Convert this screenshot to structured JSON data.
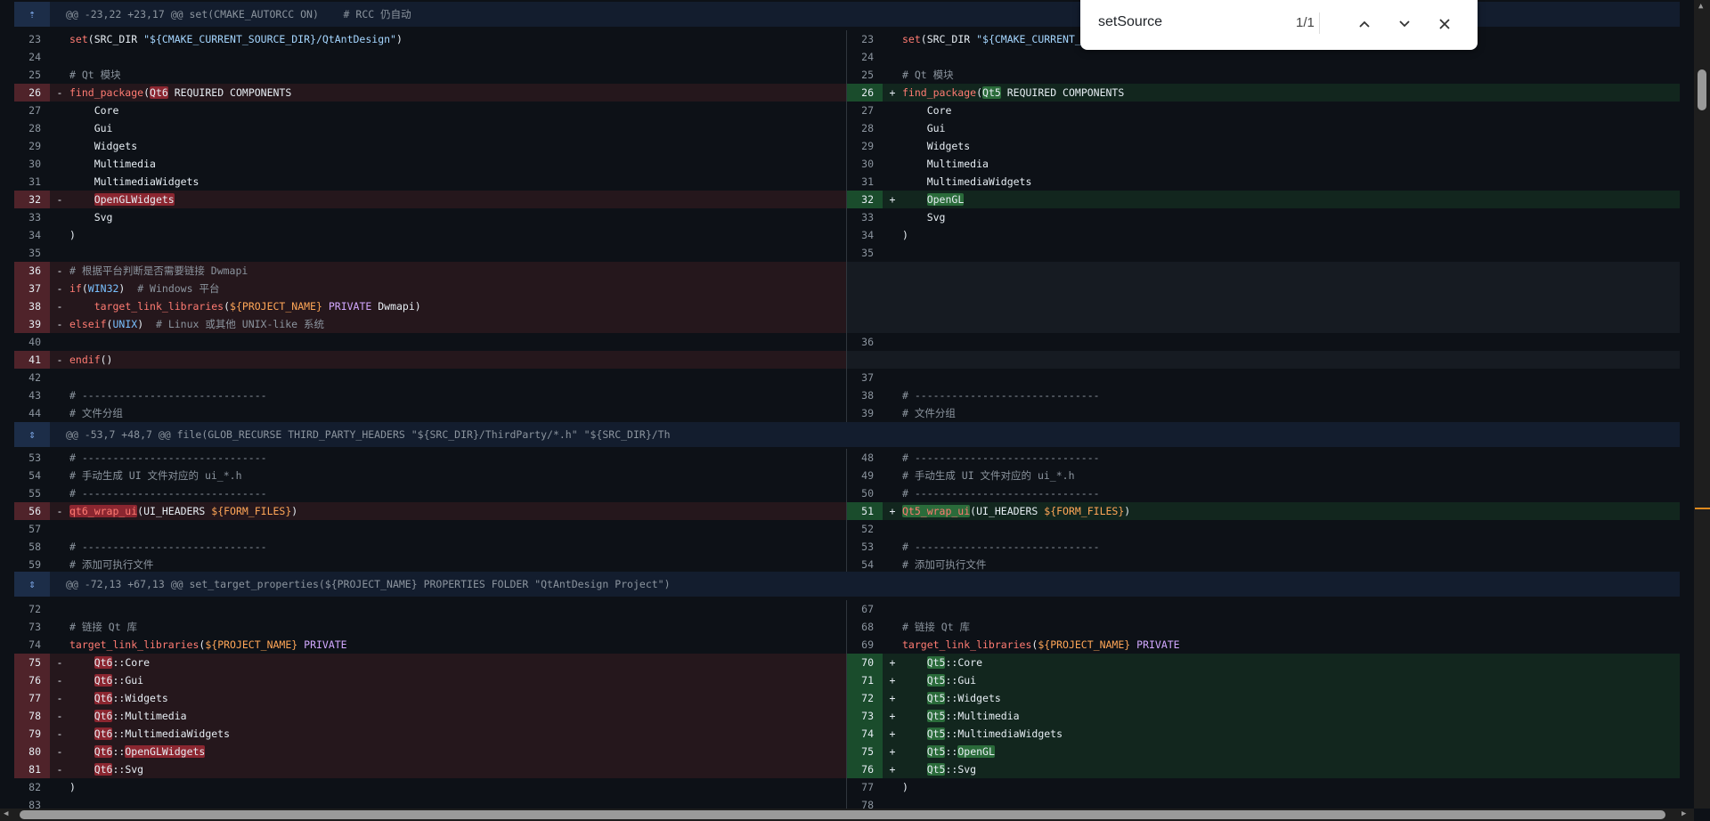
{
  "hunks": [
    {
      "text": "@@ -23,22 +23,17 @@ set(CMAKE_AUTORCC ON)    # RCC 仍自动",
      "expand_icon": "expand-up-icon"
    },
    {
      "text": "@@ -53,7 +48,7 @@ file(GLOB_RECURSE THIRD_PARTY_HEADERS \"${SRC_DIR}/ThirdParty/*.h\" \"${SRC_DIR}/Th",
      "expand_icon": "expand-both-icon"
    },
    {
      "text": "@@ -72,13 +67,13 @@ set_target_properties(${PROJECT_NAME} PROPERTIES FOLDER \"QtAntDesign Project\")",
      "expand_icon": "expand-both-icon"
    }
  ],
  "sections": [
    [
      {
        "l": {
          "n": "23",
          "c": "set(SRC_DIR \"${CMAKE_CURRENT_SOURCE_DIR}/QtAntDesign\")"
        },
        "r": {
          "n": "23",
          "c": "set(SRC_DIR \"${CMAKE_CURRENT_SOURCE_DIR}/QtAntDesign\")"
        }
      },
      {
        "l": {
          "n": "24",
          "c": ""
        },
        "r": {
          "n": "24",
          "c": ""
        }
      },
      {
        "l": {
          "n": "25",
          "c": "# Qt 模块"
        },
        "r": {
          "n": "25",
          "c": "# Qt 模块"
        }
      },
      {
        "l": {
          "n": "26",
          "c": "find_package(Qt6 REQUIRED COMPONENTS",
          "t": "del"
        },
        "r": {
          "n": "26",
          "c": "find_package(Qt5 REQUIRED COMPONENTS",
          "t": "add"
        }
      },
      {
        "l": {
          "n": "27",
          "c": "    Core"
        },
        "r": {
          "n": "27",
          "c": "    Core"
        }
      },
      {
        "l": {
          "n": "28",
          "c": "    Gui"
        },
        "r": {
          "n": "28",
          "c": "    Gui"
        }
      },
      {
        "l": {
          "n": "29",
          "c": "    Widgets"
        },
        "r": {
          "n": "29",
          "c": "    Widgets"
        }
      },
      {
        "l": {
          "n": "30",
          "c": "    Multimedia"
        },
        "r": {
          "n": "30",
          "c": "    Multimedia"
        }
      },
      {
        "l": {
          "n": "31",
          "c": "    MultimediaWidgets"
        },
        "r": {
          "n": "31",
          "c": "    MultimediaWidgets"
        }
      },
      {
        "l": {
          "n": "32",
          "c": "    OpenGLWidgets",
          "t": "del"
        },
        "r": {
          "n": "32",
          "c": "    OpenGL",
          "t": "add"
        }
      },
      {
        "l": {
          "n": "33",
          "c": "    Svg"
        },
        "r": {
          "n": "33",
          "c": "    Svg"
        }
      },
      {
        "l": {
          "n": "34",
          "c": ")"
        },
        "r": {
          "n": "34",
          "c": ")"
        }
      },
      {
        "l": {
          "n": "35",
          "c": ""
        },
        "r": {
          "n": "35",
          "c": ""
        }
      },
      {
        "l": {
          "n": "36",
          "c": "# 根据平台判断是否需要链接 Dwmapi",
          "t": "del"
        },
        "r": {
          "t": "empty"
        }
      },
      {
        "l": {
          "n": "37",
          "c": "if(WIN32)  # Windows 平台",
          "t": "del"
        },
        "r": {
          "t": "empty"
        }
      },
      {
        "l": {
          "n": "38",
          "c": "    target_link_libraries(${PROJECT_NAME} PRIVATE Dwmapi)",
          "t": "del"
        },
        "r": {
          "t": "empty"
        }
      },
      {
        "l": {
          "n": "39",
          "c": "elseif(UNIX)  # Linux 或其他 UNIX-like 系统",
          "t": "del"
        },
        "r": {
          "t": "empty"
        }
      },
      {
        "l": {
          "n": "40",
          "c": ""
        },
        "r": {
          "n": "36",
          "c": ""
        }
      },
      {
        "l": {
          "n": "41",
          "c": "endif()",
          "t": "del"
        },
        "r": {
          "t": "empty"
        }
      },
      {
        "l": {
          "n": "42",
          "c": ""
        },
        "r": {
          "n": "37",
          "c": ""
        }
      },
      {
        "l": {
          "n": "43",
          "c": "# ------------------------------"
        },
        "r": {
          "n": "38",
          "c": "# ------------------------------"
        }
      },
      {
        "l": {
          "n": "44",
          "c": "# 文件分组"
        },
        "r": {
          "n": "39",
          "c": "# 文件分组"
        }
      }
    ],
    [
      {
        "l": {
          "n": "53",
          "c": "# ------------------------------"
        },
        "r": {
          "n": "48",
          "c": "# ------------------------------"
        }
      },
      {
        "l": {
          "n": "54",
          "c": "# 手动生成 UI 文件对应的 ui_*.h"
        },
        "r": {
          "n": "49",
          "c": "# 手动生成 UI 文件对应的 ui_*.h"
        }
      },
      {
        "l": {
          "n": "55",
          "c": "# ------------------------------"
        },
        "r": {
          "n": "50",
          "c": "# ------------------------------"
        }
      },
      {
        "l": {
          "n": "56",
          "c": "qt6_wrap_ui(UI_HEADERS ${FORM_FILES})",
          "t": "del"
        },
        "r": {
          "n": "51",
          "c": "Qt5_wrap_ui(UI_HEADERS ${FORM_FILES})",
          "t": "add"
        }
      },
      {
        "l": {
          "n": "57",
          "c": ""
        },
        "r": {
          "n": "52",
          "c": ""
        }
      },
      {
        "l": {
          "n": "58",
          "c": "# ------------------------------"
        },
        "r": {
          "n": "53",
          "c": "# ------------------------------"
        }
      },
      {
        "l": {
          "n": "59",
          "c": "# 添加可执行文件"
        },
        "r": {
          "n": "54",
          "c": "# 添加可执行文件"
        }
      }
    ],
    [
      {
        "l": {
          "n": "72",
          "c": ""
        },
        "r": {
          "n": "67",
          "c": ""
        }
      },
      {
        "l": {
          "n": "73",
          "c": "# 链接 Qt 库"
        },
        "r": {
          "n": "68",
          "c": "# 链接 Qt 库"
        }
      },
      {
        "l": {
          "n": "74",
          "c": "target_link_libraries(${PROJECT_NAME} PRIVATE"
        },
        "r": {
          "n": "69",
          "c": "target_link_libraries(${PROJECT_NAME} PRIVATE"
        }
      },
      {
        "l": {
          "n": "75",
          "c": "    Qt6::Core",
          "t": "del"
        },
        "r": {
          "n": "70",
          "c": "    Qt5::Core",
          "t": "add"
        }
      },
      {
        "l": {
          "n": "76",
          "c": "    Qt6::Gui",
          "t": "del"
        },
        "r": {
          "n": "71",
          "c": "    Qt5::Gui",
          "t": "add"
        }
      },
      {
        "l": {
          "n": "77",
          "c": "    Qt6::Widgets",
          "t": "del"
        },
        "r": {
          "n": "72",
          "c": "    Qt5::Widgets",
          "t": "add"
        }
      },
      {
        "l": {
          "n": "78",
          "c": "    Qt6::Multimedia",
          "t": "del"
        },
        "r": {
          "n": "73",
          "c": "    Qt5::Multimedia",
          "t": "add"
        }
      },
      {
        "l": {
          "n": "79",
          "c": "    Qt6::MultimediaWidgets",
          "t": "del"
        },
        "r": {
          "n": "74",
          "c": "    Qt5::MultimediaWidgets",
          "t": "add"
        }
      },
      {
        "l": {
          "n": "80",
          "c": "    Qt6::OpenGLWidgets",
          "t": "del"
        },
        "r": {
          "n": "75",
          "c": "    Qt5::OpenGL",
          "t": "add"
        }
      },
      {
        "l": {
          "n": "81",
          "c": "    Qt6::Svg",
          "t": "del"
        },
        "r": {
          "n": "76",
          "c": "    Qt5::Svg",
          "t": "add"
        }
      },
      {
        "l": {
          "n": "82",
          "c": ")"
        },
        "r": {
          "n": "77",
          "c": ")"
        }
      },
      {
        "l": {
          "n": "83",
          "c": ""
        },
        "r": {
          "n": "78",
          "c": ""
        }
      }
    ]
  ],
  "markers": {
    "del": "-",
    "add": "+"
  },
  "find": {
    "query": "setSource",
    "count": "1/1",
    "prev_icon": "chevron-up-icon",
    "next_icon": "chevron-down-icon",
    "close_icon": "close-icon"
  },
  "colors": {
    "background": "#0d1117",
    "del_bg": "#25171c",
    "add_bg": "#12261e",
    "hunk_bg": "#131d2e",
    "search_match": "#e08a1e"
  }
}
